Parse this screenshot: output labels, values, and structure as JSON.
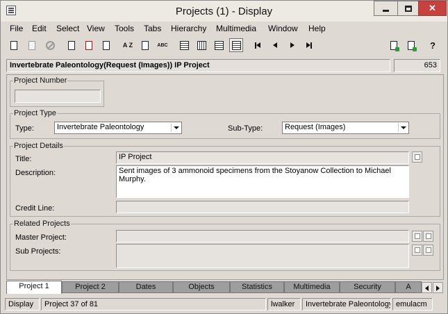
{
  "window": {
    "title": "Projects (1) - Display"
  },
  "menu": [
    "File",
    "Edit",
    "Select",
    "View",
    "Tools",
    "Tabs",
    "Hierarchy",
    "Multimedia",
    "Window",
    "Help"
  ],
  "toolbar": {
    "icons": [
      "new-record-icon",
      "save-icon",
      "cancel-icon",
      "print-icon",
      "delete-icon",
      "copy-icon",
      "sort-az-icon",
      "edit-icon",
      "spellcheck-icon",
      "form-view-icon",
      "table-view-icon",
      "page-view-icon",
      "image-view-icon",
      "first-record-icon",
      "previous-record-icon",
      "next-record-icon",
      "last-record-icon",
      "attach-icon",
      "link-icon",
      "context-help-icon"
    ],
    "az_label": "A Z",
    "abc_label": "ABC",
    "help_label": "?"
  },
  "header": {
    "record_title": "Invertebrate Paleontology(Request (Images)) IP Project",
    "record_count": "653"
  },
  "project_number": {
    "legend": "Project Number",
    "value": ""
  },
  "project_type": {
    "legend": "Project Type",
    "type_label": "Type:",
    "type_value": "Invertebrate Paleontology",
    "subtype_label": "Sub-Type:",
    "subtype_value": "Request (Images)"
  },
  "project_details": {
    "legend": "Project Details",
    "title_label": "Title:",
    "title_value": "IP Project",
    "description_label": "Description:",
    "description_value": "Sent images of 3 ammonoid specimens from the Stoyanow Collection to Michael Murphy.",
    "credit_label": "Credit Line:",
    "credit_value": ""
  },
  "related_projects": {
    "legend": "Related Projects",
    "master_label": "Master Project:",
    "master_value": "",
    "sub_label": "Sub Projects:",
    "sub_value": ""
  },
  "tabs": [
    "Project 1",
    "Project 2",
    "Dates",
    "Objects",
    "Statistics",
    "Multimedia",
    "Security",
    "A"
  ],
  "active_tab": "Project 1",
  "status": {
    "mode": "Display",
    "position": "Project 37 of 81",
    "user": "lwalker",
    "department": "Invertebrate Paleontology",
    "server": "emulacm"
  }
}
